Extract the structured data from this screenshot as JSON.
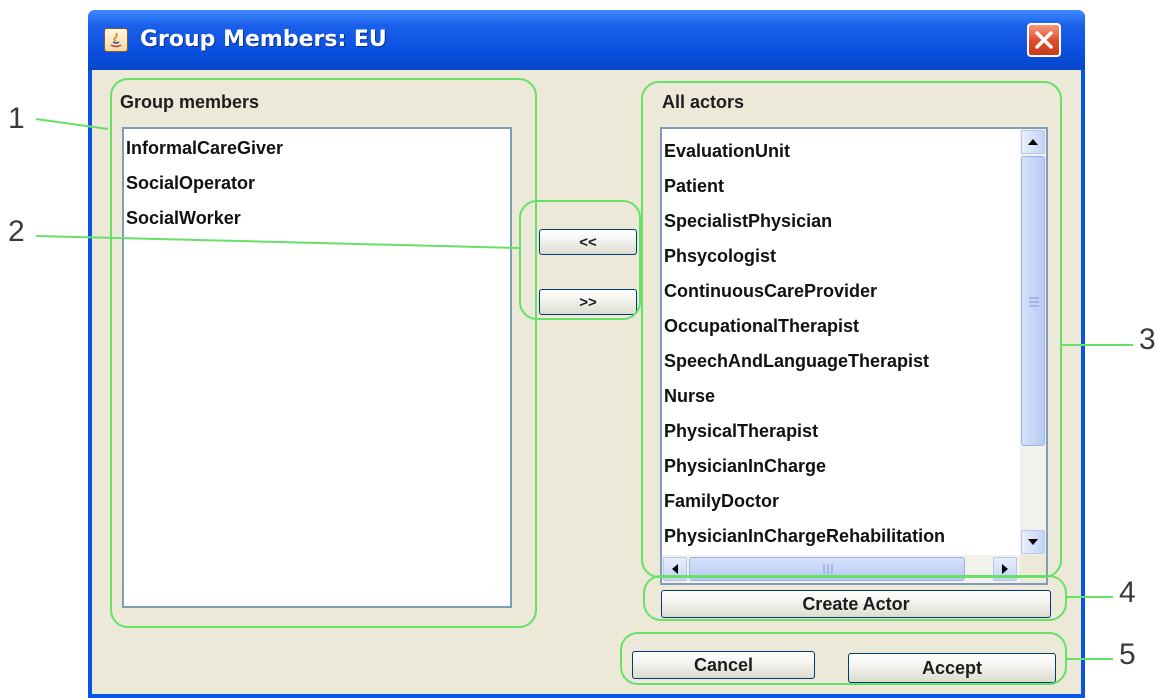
{
  "window": {
    "title": "Group Members: EU"
  },
  "group_members": {
    "label": "Group members",
    "items": [
      "InformalCareGiver",
      "SocialOperator",
      "SocialWorker"
    ]
  },
  "all_actors": {
    "label": "All actors",
    "items": [
      "EvaluationUnit",
      "Patient",
      "SpecialistPhysician",
      "Phsycologist",
      "ContinuousCareProvider",
      "OccupationalTherapist",
      "SpeechAndLanguageTherapist",
      "Nurse",
      "PhysicalTherapist",
      "PhysicianInCharge",
      "FamilyDoctor",
      "PhysicianInChargeRehabilitation"
    ]
  },
  "buttons": {
    "move_left": "<<",
    "move_right": ">>",
    "create_actor": "Create Actor",
    "cancel": "Cancel",
    "accept": "Accept"
  },
  "callouts": [
    "1",
    "2",
    "3",
    "4",
    "5"
  ],
  "colors": {
    "titlebar": "#0a54e2",
    "client_bg": "#ece9d8",
    "annotation_green": "#66e066",
    "close_button": "#e0502e"
  },
  "icons": [
    "java-app-icon",
    "close-icon",
    "scroll-up-icon",
    "scroll-down-icon",
    "scroll-left-icon",
    "scroll-right-icon",
    "scroll-grip-icon"
  ]
}
